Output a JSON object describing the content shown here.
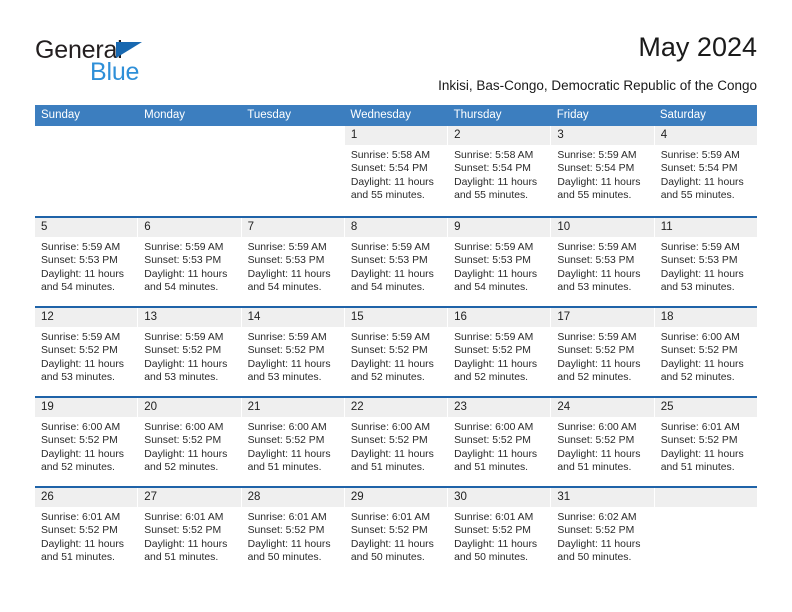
{
  "brand": {
    "name_part1": "General",
    "name_part2": "Blue",
    "triangle_color": "#1868b0",
    "blue_color": "#2e8fd8"
  },
  "header": {
    "title": "May 2024",
    "subtitle": "Inkisi, Bas-Congo, Democratic Republic of the Congo"
  },
  "theme": {
    "header_blue": "#3c7ebf",
    "row_divider_blue": "#1f63a8",
    "day_number_bg": "#efefef"
  },
  "weekdays": [
    "Sunday",
    "Monday",
    "Tuesday",
    "Wednesday",
    "Thursday",
    "Friday",
    "Saturday"
  ],
  "weeks": [
    [
      {
        "day": "",
        "sunrise": "",
        "sunset": "",
        "daylight1": "",
        "daylight2": "",
        "blank": true
      },
      {
        "day": "",
        "sunrise": "",
        "sunset": "",
        "daylight1": "",
        "daylight2": "",
        "blank": true
      },
      {
        "day": "",
        "sunrise": "",
        "sunset": "",
        "daylight1": "",
        "daylight2": "",
        "blank": true
      },
      {
        "day": "1",
        "sunrise": "Sunrise: 5:58 AM",
        "sunset": "Sunset: 5:54 PM",
        "daylight1": "Daylight: 11 hours",
        "daylight2": "and 55 minutes."
      },
      {
        "day": "2",
        "sunrise": "Sunrise: 5:58 AM",
        "sunset": "Sunset: 5:54 PM",
        "daylight1": "Daylight: 11 hours",
        "daylight2": "and 55 minutes."
      },
      {
        "day": "3",
        "sunrise": "Sunrise: 5:59 AM",
        "sunset": "Sunset: 5:54 PM",
        "daylight1": "Daylight: 11 hours",
        "daylight2": "and 55 minutes."
      },
      {
        "day": "4",
        "sunrise": "Sunrise: 5:59 AM",
        "sunset": "Sunset: 5:54 PM",
        "daylight1": "Daylight: 11 hours",
        "daylight2": "and 55 minutes."
      }
    ],
    [
      {
        "day": "5",
        "sunrise": "Sunrise: 5:59 AM",
        "sunset": "Sunset: 5:53 PM",
        "daylight1": "Daylight: 11 hours",
        "daylight2": "and 54 minutes."
      },
      {
        "day": "6",
        "sunrise": "Sunrise: 5:59 AM",
        "sunset": "Sunset: 5:53 PM",
        "daylight1": "Daylight: 11 hours",
        "daylight2": "and 54 minutes."
      },
      {
        "day": "7",
        "sunrise": "Sunrise: 5:59 AM",
        "sunset": "Sunset: 5:53 PM",
        "daylight1": "Daylight: 11 hours",
        "daylight2": "and 54 minutes."
      },
      {
        "day": "8",
        "sunrise": "Sunrise: 5:59 AM",
        "sunset": "Sunset: 5:53 PM",
        "daylight1": "Daylight: 11 hours",
        "daylight2": "and 54 minutes."
      },
      {
        "day": "9",
        "sunrise": "Sunrise: 5:59 AM",
        "sunset": "Sunset: 5:53 PM",
        "daylight1": "Daylight: 11 hours",
        "daylight2": "and 54 minutes."
      },
      {
        "day": "10",
        "sunrise": "Sunrise: 5:59 AM",
        "sunset": "Sunset: 5:53 PM",
        "daylight1": "Daylight: 11 hours",
        "daylight2": "and 53 minutes."
      },
      {
        "day": "11",
        "sunrise": "Sunrise: 5:59 AM",
        "sunset": "Sunset: 5:53 PM",
        "daylight1": "Daylight: 11 hours",
        "daylight2": "and 53 minutes."
      }
    ],
    [
      {
        "day": "12",
        "sunrise": "Sunrise: 5:59 AM",
        "sunset": "Sunset: 5:52 PM",
        "daylight1": "Daylight: 11 hours",
        "daylight2": "and 53 minutes."
      },
      {
        "day": "13",
        "sunrise": "Sunrise: 5:59 AM",
        "sunset": "Sunset: 5:52 PM",
        "daylight1": "Daylight: 11 hours",
        "daylight2": "and 53 minutes."
      },
      {
        "day": "14",
        "sunrise": "Sunrise: 5:59 AM",
        "sunset": "Sunset: 5:52 PM",
        "daylight1": "Daylight: 11 hours",
        "daylight2": "and 53 minutes."
      },
      {
        "day": "15",
        "sunrise": "Sunrise: 5:59 AM",
        "sunset": "Sunset: 5:52 PM",
        "daylight1": "Daylight: 11 hours",
        "daylight2": "and 52 minutes."
      },
      {
        "day": "16",
        "sunrise": "Sunrise: 5:59 AM",
        "sunset": "Sunset: 5:52 PM",
        "daylight1": "Daylight: 11 hours",
        "daylight2": "and 52 minutes."
      },
      {
        "day": "17",
        "sunrise": "Sunrise: 5:59 AM",
        "sunset": "Sunset: 5:52 PM",
        "daylight1": "Daylight: 11 hours",
        "daylight2": "and 52 minutes."
      },
      {
        "day": "18",
        "sunrise": "Sunrise: 6:00 AM",
        "sunset": "Sunset: 5:52 PM",
        "daylight1": "Daylight: 11 hours",
        "daylight2": "and 52 minutes."
      }
    ],
    [
      {
        "day": "19",
        "sunrise": "Sunrise: 6:00 AM",
        "sunset": "Sunset: 5:52 PM",
        "daylight1": "Daylight: 11 hours",
        "daylight2": "and 52 minutes."
      },
      {
        "day": "20",
        "sunrise": "Sunrise: 6:00 AM",
        "sunset": "Sunset: 5:52 PM",
        "daylight1": "Daylight: 11 hours",
        "daylight2": "and 52 minutes."
      },
      {
        "day": "21",
        "sunrise": "Sunrise: 6:00 AM",
        "sunset": "Sunset: 5:52 PM",
        "daylight1": "Daylight: 11 hours",
        "daylight2": "and 51 minutes."
      },
      {
        "day": "22",
        "sunrise": "Sunrise: 6:00 AM",
        "sunset": "Sunset: 5:52 PM",
        "daylight1": "Daylight: 11 hours",
        "daylight2": "and 51 minutes."
      },
      {
        "day": "23",
        "sunrise": "Sunrise: 6:00 AM",
        "sunset": "Sunset: 5:52 PM",
        "daylight1": "Daylight: 11 hours",
        "daylight2": "and 51 minutes."
      },
      {
        "day": "24",
        "sunrise": "Sunrise: 6:00 AM",
        "sunset": "Sunset: 5:52 PM",
        "daylight1": "Daylight: 11 hours",
        "daylight2": "and 51 minutes."
      },
      {
        "day": "25",
        "sunrise": "Sunrise: 6:01 AM",
        "sunset": "Sunset: 5:52 PM",
        "daylight1": "Daylight: 11 hours",
        "daylight2": "and 51 minutes."
      }
    ],
    [
      {
        "day": "26",
        "sunrise": "Sunrise: 6:01 AM",
        "sunset": "Sunset: 5:52 PM",
        "daylight1": "Daylight: 11 hours",
        "daylight2": "and 51 minutes."
      },
      {
        "day": "27",
        "sunrise": "Sunrise: 6:01 AM",
        "sunset": "Sunset: 5:52 PM",
        "daylight1": "Daylight: 11 hours",
        "daylight2": "and 51 minutes."
      },
      {
        "day": "28",
        "sunrise": "Sunrise: 6:01 AM",
        "sunset": "Sunset: 5:52 PM",
        "daylight1": "Daylight: 11 hours",
        "daylight2": "and 50 minutes."
      },
      {
        "day": "29",
        "sunrise": "Sunrise: 6:01 AM",
        "sunset": "Sunset: 5:52 PM",
        "daylight1": "Daylight: 11 hours",
        "daylight2": "and 50 minutes."
      },
      {
        "day": "30",
        "sunrise": "Sunrise: 6:01 AM",
        "sunset": "Sunset: 5:52 PM",
        "daylight1": "Daylight: 11 hours",
        "daylight2": "and 50 minutes."
      },
      {
        "day": "31",
        "sunrise": "Sunrise: 6:02 AM",
        "sunset": "Sunset: 5:52 PM",
        "daylight1": "Daylight: 11 hours",
        "daylight2": "and 50 minutes."
      },
      {
        "day": "",
        "sunrise": "",
        "sunset": "",
        "daylight1": "",
        "daylight2": "",
        "empty": true
      }
    ]
  ]
}
